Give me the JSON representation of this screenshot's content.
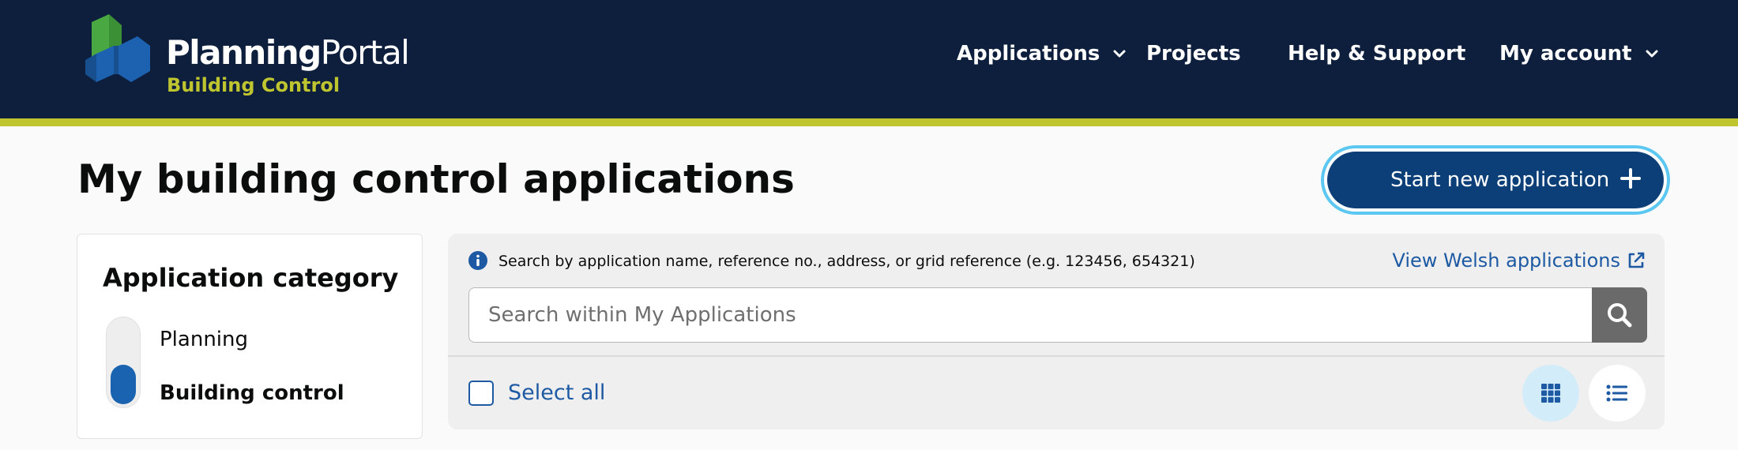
{
  "brand": {
    "name_strong": "Planning",
    "name_light": "Portal",
    "subtitle": "Building Control",
    "logo_icon": "planning-portal-logo",
    "colors": {
      "navy": "#0e1f3d",
      "lime": "#bfc52f",
      "green": "#4aa842",
      "blue": "#1c62b0"
    }
  },
  "nav": {
    "items": [
      {
        "label": "Applications",
        "has_dropdown": true
      },
      {
        "label": "Projects",
        "has_dropdown": false
      },
      {
        "label": "Help & Support",
        "has_dropdown": false
      },
      {
        "label": "My account",
        "has_dropdown": true
      }
    ]
  },
  "page": {
    "title": "My building control applications",
    "start_button": {
      "label": "Start new application",
      "icon": "plus-icon"
    }
  },
  "filter": {
    "title": "Application category",
    "options": [
      "Planning",
      "Building control"
    ],
    "selected": "Building control"
  },
  "search": {
    "hint": "Search by application name, reference no., address, or grid reference (e.g. 123456, 654321)",
    "welsh_link": "View Welsh applications",
    "placeholder": "Search within My Applications",
    "value": "",
    "select_all_label": "Select all",
    "views": [
      {
        "icon": "grid-view-icon",
        "active": true
      },
      {
        "icon": "list-view-icon",
        "active": false
      }
    ]
  }
}
